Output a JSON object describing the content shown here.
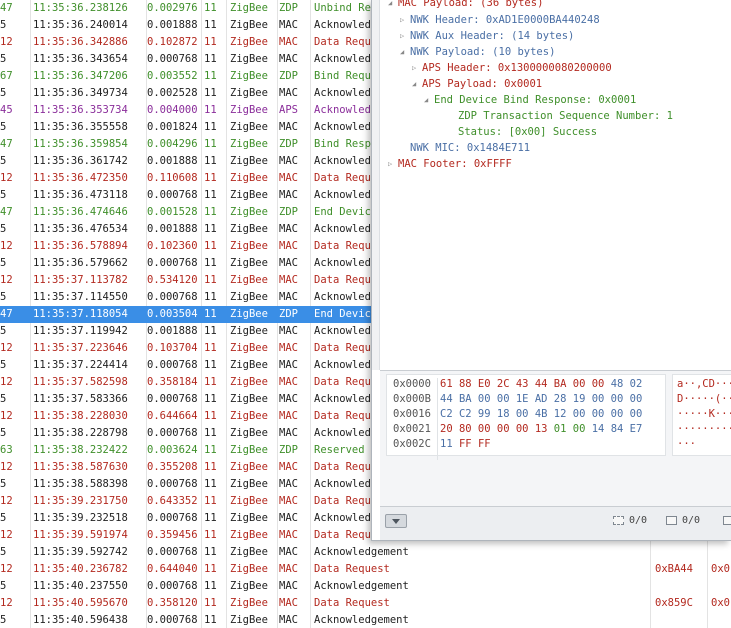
{
  "packets": [
    {
      "no": "47",
      "time": "11:35:36.238126",
      "delta": "0.002976",
      "ch": "11",
      "proto": "ZigBee",
      "layer": "ZDP",
      "info": "Unbind Re",
      "x1": "",
      "x2": "",
      "color": "green"
    },
    {
      "no": "5",
      "time": "11:35:36.240014",
      "delta": "0.001888",
      "ch": "11",
      "proto": "ZigBee",
      "layer": "MAC",
      "info": "Acknowled",
      "x1": "",
      "x2": "",
      "color": "black"
    },
    {
      "no": "12",
      "time": "11:35:36.342886",
      "delta": "0.102872",
      "ch": "11",
      "proto": "ZigBee",
      "layer": "MAC",
      "info": "Data Requ",
      "x1": "",
      "x2": "",
      "color": "red"
    },
    {
      "no": "5",
      "time": "11:35:36.343654",
      "delta": "0.000768",
      "ch": "11",
      "proto": "ZigBee",
      "layer": "MAC",
      "info": "Acknowled",
      "x1": "",
      "x2": "",
      "color": "black"
    },
    {
      "no": "67",
      "time": "11:35:36.347206",
      "delta": "0.003552",
      "ch": "11",
      "proto": "ZigBee",
      "layer": "ZDP",
      "info": "Bind Requ",
      "x1": "",
      "x2": "",
      "color": "green"
    },
    {
      "no": "5",
      "time": "11:35:36.349734",
      "delta": "0.002528",
      "ch": "11",
      "proto": "ZigBee",
      "layer": "MAC",
      "info": "Acknowled",
      "x1": "",
      "x2": "",
      "color": "black"
    },
    {
      "no": "45",
      "time": "11:35:36.353734",
      "delta": "0.004000",
      "ch": "11",
      "proto": "ZigBee",
      "layer": "APS",
      "info": "Acknowled",
      "x1": "",
      "x2": "",
      "color": "purple"
    },
    {
      "no": "5",
      "time": "11:35:36.355558",
      "delta": "0.001824",
      "ch": "11",
      "proto": "ZigBee",
      "layer": "MAC",
      "info": "Acknowled",
      "x1": "",
      "x2": "",
      "color": "black"
    },
    {
      "no": "47",
      "time": "11:35:36.359854",
      "delta": "0.004296",
      "ch": "11",
      "proto": "ZigBee",
      "layer": "ZDP",
      "info": "Bind Resp",
      "x1": "",
      "x2": "",
      "color": "green"
    },
    {
      "no": "5",
      "time": "11:35:36.361742",
      "delta": "0.001888",
      "ch": "11",
      "proto": "ZigBee",
      "layer": "MAC",
      "info": "Acknowled",
      "x1": "",
      "x2": "",
      "color": "black"
    },
    {
      "no": "12",
      "time": "11:35:36.472350",
      "delta": "0.110608",
      "ch": "11",
      "proto": "ZigBee",
      "layer": "MAC",
      "info": "Data Requ",
      "x1": "",
      "x2": "",
      "color": "red"
    },
    {
      "no": "5",
      "time": "11:35:36.473118",
      "delta": "0.000768",
      "ch": "11",
      "proto": "ZigBee",
      "layer": "MAC",
      "info": "Acknowled",
      "x1": "",
      "x2": "",
      "color": "black"
    },
    {
      "no": "47",
      "time": "11:35:36.474646",
      "delta": "0.001528",
      "ch": "11",
      "proto": "ZigBee",
      "layer": "ZDP",
      "info": "End Devic",
      "x1": "",
      "x2": "",
      "color": "green"
    },
    {
      "no": "5",
      "time": "11:35:36.476534",
      "delta": "0.001888",
      "ch": "11",
      "proto": "ZigBee",
      "layer": "MAC",
      "info": "Acknowled",
      "x1": "",
      "x2": "",
      "color": "black"
    },
    {
      "no": "12",
      "time": "11:35:36.578894",
      "delta": "0.102360",
      "ch": "11",
      "proto": "ZigBee",
      "layer": "MAC",
      "info": "Data Requ",
      "x1": "",
      "x2": "",
      "color": "red"
    },
    {
      "no": "5",
      "time": "11:35:36.579662",
      "delta": "0.000768",
      "ch": "11",
      "proto": "ZigBee",
      "layer": "MAC",
      "info": "Acknowled",
      "x1": "",
      "x2": "",
      "color": "black"
    },
    {
      "no": "12",
      "time": "11:35:37.113782",
      "delta": "0.534120",
      "ch": "11",
      "proto": "ZigBee",
      "layer": "MAC",
      "info": "Data Requ",
      "x1": "",
      "x2": "",
      "color": "red"
    },
    {
      "no": "5",
      "time": "11:35:37.114550",
      "delta": "0.000768",
      "ch": "11",
      "proto": "ZigBee",
      "layer": "MAC",
      "info": "Acknowled",
      "x1": "",
      "x2": "",
      "color": "black"
    },
    {
      "no": "47",
      "time": "11:35:37.118054",
      "delta": "0.003504",
      "ch": "11",
      "proto": "ZigBee",
      "layer": "ZDP",
      "info": "End Devic",
      "x1": "",
      "x2": "",
      "color": "green",
      "selected": true
    },
    {
      "no": "5",
      "time": "11:35:37.119942",
      "delta": "0.001888",
      "ch": "11",
      "proto": "ZigBee",
      "layer": "MAC",
      "info": "Acknowled",
      "x1": "",
      "x2": "",
      "color": "black"
    },
    {
      "no": "12",
      "time": "11:35:37.223646",
      "delta": "0.103704",
      "ch": "11",
      "proto": "ZigBee",
      "layer": "MAC",
      "info": "Data Requ",
      "x1": "",
      "x2": "",
      "color": "red"
    },
    {
      "no": "5",
      "time": "11:35:37.224414",
      "delta": "0.000768",
      "ch": "11",
      "proto": "ZigBee",
      "layer": "MAC",
      "info": "Acknowled",
      "x1": "",
      "x2": "",
      "color": "black"
    },
    {
      "no": "12",
      "time": "11:35:37.582598",
      "delta": "0.358184",
      "ch": "11",
      "proto": "ZigBee",
      "layer": "MAC",
      "info": "Data Requ",
      "x1": "",
      "x2": "",
      "color": "red"
    },
    {
      "no": "5",
      "time": "11:35:37.583366",
      "delta": "0.000768",
      "ch": "11",
      "proto": "ZigBee",
      "layer": "MAC",
      "info": "Acknowled",
      "x1": "",
      "x2": "",
      "color": "black"
    },
    {
      "no": "12",
      "time": "11:35:38.228030",
      "delta": "0.644664",
      "ch": "11",
      "proto": "ZigBee",
      "layer": "MAC",
      "info": "Data Requ",
      "x1": "",
      "x2": "",
      "color": "red"
    },
    {
      "no": "5",
      "time": "11:35:38.228798",
      "delta": "0.000768",
      "ch": "11",
      "proto": "ZigBee",
      "layer": "MAC",
      "info": "Acknowled",
      "x1": "",
      "x2": "",
      "color": "black"
    },
    {
      "no": "63",
      "time": "11:35:38.232422",
      "delta": "0.003624",
      "ch": "11",
      "proto": "ZigBee",
      "layer": "ZDP",
      "info": "Reserved",
      "x1": "",
      "x2": "",
      "color": "green"
    },
    {
      "no": "12",
      "time": "11:35:38.587630",
      "delta": "0.355208",
      "ch": "11",
      "proto": "ZigBee",
      "layer": "MAC",
      "info": "Data Requ",
      "x1": "",
      "x2": "",
      "color": "red"
    },
    {
      "no": "5",
      "time": "11:35:38.588398",
      "delta": "0.000768",
      "ch": "11",
      "proto": "ZigBee",
      "layer": "MAC",
      "info": "Acknowled",
      "x1": "",
      "x2": "",
      "color": "black"
    },
    {
      "no": "12",
      "time": "11:35:39.231750",
      "delta": "0.643352",
      "ch": "11",
      "proto": "ZigBee",
      "layer": "MAC",
      "info": "Data Requ",
      "x1": "",
      "x2": "",
      "color": "red"
    },
    {
      "no": "5",
      "time": "11:35:39.232518",
      "delta": "0.000768",
      "ch": "11",
      "proto": "ZigBee",
      "layer": "MAC",
      "info": "Acknowled",
      "x1": "",
      "x2": "",
      "color": "black"
    },
    {
      "no": "12",
      "time": "11:35:39.591974",
      "delta": "0.359456",
      "ch": "11",
      "proto": "ZigBee",
      "layer": "MAC",
      "info": "Data Requ",
      "x1": "",
      "x2": "",
      "color": "red"
    },
    {
      "no": "5",
      "time": "11:35:39.592742",
      "delta": "0.000768",
      "ch": "11",
      "proto": "ZigBee",
      "layer": "MAC",
      "info": "Acknowledgement",
      "x1": "",
      "x2": "",
      "color": "black"
    },
    {
      "no": "12",
      "time": "11:35:40.236782",
      "delta": "0.644040",
      "ch": "11",
      "proto": "ZigBee",
      "layer": "MAC",
      "info": "Data Request",
      "x1": "0xBA44",
      "x2": "0x0",
      "color": "red"
    },
    {
      "no": "5",
      "time": "11:35:40.237550",
      "delta": "0.000768",
      "ch": "11",
      "proto": "ZigBee",
      "layer": "MAC",
      "info": "Acknowledgement",
      "x1": "",
      "x2": "",
      "color": "black"
    },
    {
      "no": "12",
      "time": "11:35:40.595670",
      "delta": "0.358120",
      "ch": "11",
      "proto": "ZigBee",
      "layer": "MAC",
      "info": "Data Request",
      "x1": "0x859C",
      "x2": "0x0",
      "color": "red"
    },
    {
      "no": "5",
      "time": "11:35:40.596438",
      "delta": "0.000768",
      "ch": "11",
      "proto": "ZigBee",
      "layer": "MAC",
      "info": "Acknowledgement",
      "x1": "",
      "x2": "",
      "color": "black"
    }
  ],
  "tree": [
    {
      "text": "MAC Payload: (36 bytes)",
      "indent": 0,
      "toggle": "open",
      "color": "mac"
    },
    {
      "text": "NWK Header: 0xAD1E0000BA440248",
      "indent": 1,
      "toggle": "closed",
      "color": "nwk"
    },
    {
      "text": "NWK Aux Header: (14 bytes)",
      "indent": 1,
      "toggle": "closed",
      "color": "nwk"
    },
    {
      "text": "NWK Payload: (10 bytes)",
      "indent": 1,
      "toggle": "open",
      "color": "nwk"
    },
    {
      "text": "APS Header: 0x1300000080200000",
      "indent": 2,
      "toggle": "closed",
      "color": "aps"
    },
    {
      "text": "APS Payload: 0x0001",
      "indent": 2,
      "toggle": "open",
      "color": "aps"
    },
    {
      "text": "End Device Bind Response: 0x0001",
      "indent": 3,
      "toggle": "open",
      "color": "zdpgreen"
    },
    {
      "text": "ZDP Transaction Sequence Number: 1",
      "indent": 5,
      "toggle": "none",
      "color": "zdpgreen"
    },
    {
      "text": "Status: [0x00] Success",
      "indent": 5,
      "toggle": "none",
      "color": "zdpgreen"
    },
    {
      "text": "NWK MIC: 0x1484E711",
      "indent": 1,
      "toggle": "none",
      "color": "nwk"
    },
    {
      "text": "MAC Footer: 0xFFFF",
      "indent": 0,
      "toggle": "closed",
      "color": "mac"
    }
  ],
  "hex": [
    {
      "offset": "0x0000",
      "bytes": [
        [
          "61 88 E0 2C 43 44 BA 00 00",
          "red"
        ],
        [
          " 48 02",
          "blue"
        ]
      ],
      "ascii": "a··,CD···H"
    },
    {
      "offset": "0x000B",
      "bytes": [
        [
          "44 BA 00 00 1E AD 28 19 00 00 00",
          "blue"
        ]
      ],
      "ascii": "D·····(···"
    },
    {
      "offset": "0x0016",
      "bytes": [
        [
          "C2 C2 99 18 00 4B 12 00 00 00 00",
          "blue"
        ]
      ],
      "ascii": "·····K····"
    },
    {
      "offset": "0x0021",
      "bytes": [
        [
          "20 80 00 00 00 13",
          "red"
        ],
        [
          " 01 00",
          "green"
        ],
        [
          " 14 84 E7",
          "blue"
        ]
      ],
      "ascii": " ·········"
    },
    {
      "offset": "0x002C",
      "bytes": [
        [
          "11",
          "blue"
        ],
        [
          " FF FF",
          "red"
        ]
      ],
      "ascii": "···"
    }
  ],
  "status": {
    "count1": "0/0",
    "count2": "0/0"
  },
  "colors": {
    "green": "#3f8f2a",
    "red": "#b3291f",
    "purple": "#8a2d9a",
    "black": "#222222",
    "selected": "#3a8ee6"
  }
}
